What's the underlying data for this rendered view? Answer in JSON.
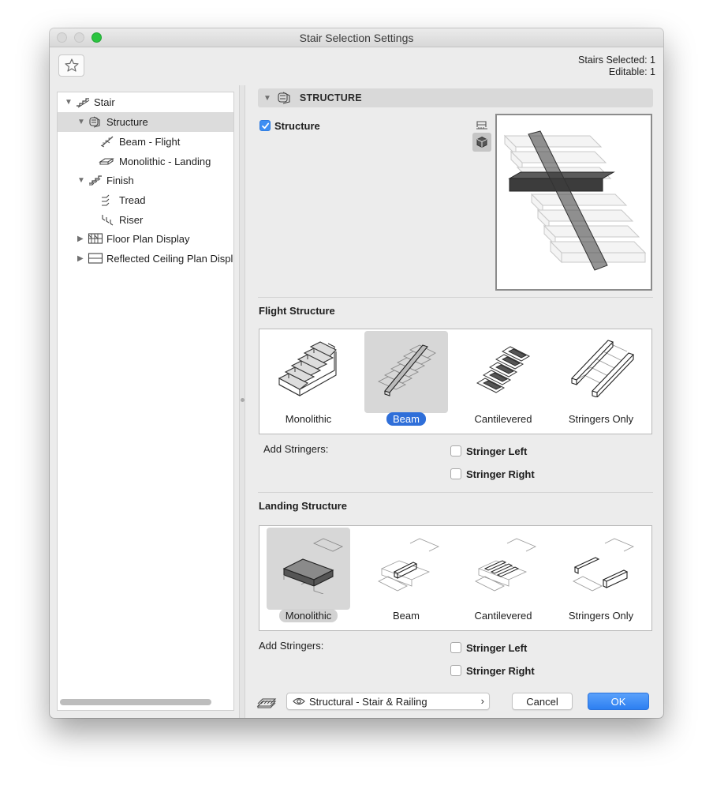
{
  "window": {
    "title": "Stair Selection Settings"
  },
  "toolbar": {
    "favorites_icon": "star-icon"
  },
  "selection_info": {
    "stairs_selected": "Stairs Selected: 1",
    "editable": "Editable: 1"
  },
  "tree": {
    "items": [
      {
        "label": "Stair",
        "icon": "stair-icon",
        "expanded": true
      },
      {
        "label": "Structure",
        "icon": "structure-icon",
        "expanded": true,
        "selected": true
      },
      {
        "label": "Beam - Flight",
        "icon": "beam-flight-icon"
      },
      {
        "label": "Monolithic - Landing",
        "icon": "monolithic-landing-icon"
      },
      {
        "label": "Finish",
        "icon": "finish-icon",
        "expanded": true
      },
      {
        "label": "Tread",
        "icon": "tread-icon"
      },
      {
        "label": "Riser",
        "icon": "riser-icon"
      },
      {
        "label": "Floor Plan Display",
        "icon": "floor-plan-icon",
        "expanded": false
      },
      {
        "label": "Reflected Ceiling Plan Displ",
        "icon": "ceiling-plan-icon",
        "expanded": false
      }
    ]
  },
  "structure_panel": {
    "header": "STRUCTURE",
    "structure_checkbox": {
      "label": "Structure",
      "checked": true
    },
    "view_icons": [
      "plan-view-icon",
      "3d-view-icon"
    ]
  },
  "flight_structure": {
    "title": "Flight Structure",
    "options": [
      "Monolithic",
      "Beam",
      "Cantilevered",
      "Stringers Only"
    ],
    "selected": "Beam",
    "add_stringers_label": "Add Stringers:",
    "stringer_left": {
      "label": "Stringer Left",
      "checked": false
    },
    "stringer_right": {
      "label": "Stringer Right",
      "checked": false
    }
  },
  "landing_structure": {
    "title": "Landing Structure",
    "options": [
      "Monolithic",
      "Beam",
      "Cantilevered",
      "Stringers Only"
    ],
    "selected": "Monolithic",
    "add_stringers_label": "Add Stringers:",
    "stringer_left": {
      "label": "Stringer Left",
      "checked": false
    },
    "stringer_right": {
      "label": "Stringer Right",
      "checked": false
    }
  },
  "footer": {
    "view_selector": "Structural - Stair & Railing",
    "cancel_label": "Cancel",
    "ok_label": "OK"
  },
  "colors": {
    "accent": "#2f6fd9",
    "ok_button": "#2d7ff1",
    "checkbox_checked": "#3d8ef3"
  }
}
